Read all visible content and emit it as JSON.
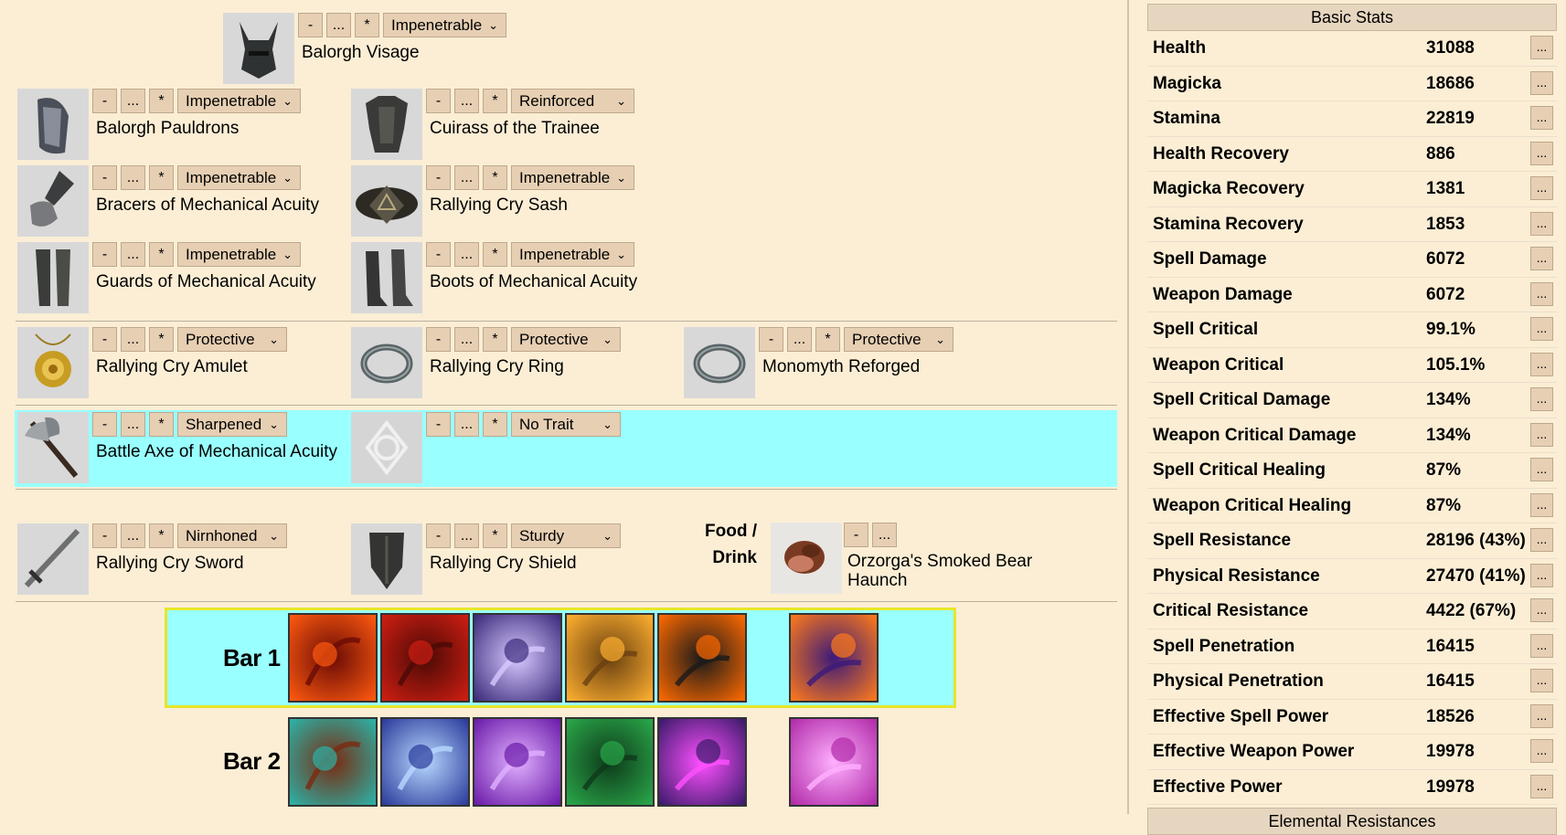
{
  "controls": {
    "minus": "-",
    "dots": "...",
    "star": "*"
  },
  "gear": {
    "head": {
      "name": "Balorgh Visage",
      "trait": "Impenetrable",
      "icon": "helmet-icon"
    },
    "shoulders": {
      "name": "Balorgh Pauldrons",
      "trait": "Impenetrable",
      "icon": "pauldron-icon"
    },
    "chest": {
      "name": "Cuirass of the Trainee",
      "trait": "Reinforced",
      "icon": "cuirass-icon"
    },
    "hands": {
      "name": "Bracers of Mechanical Acuity",
      "trait": "Impenetrable",
      "icon": "gauntlet-icon"
    },
    "waist": {
      "name": "Rallying Cry Sash",
      "trait": "Impenetrable",
      "icon": "belt-icon"
    },
    "legs": {
      "name": "Guards of Mechanical Acuity",
      "trait": "Impenetrable",
      "icon": "greaves-icon"
    },
    "feet": {
      "name": "Boots of Mechanical Acuity",
      "trait": "Impenetrable",
      "icon": "boots-icon"
    },
    "neck": {
      "name": "Rallying Cry Amulet",
      "trait": "Protective",
      "icon": "amulet-icon"
    },
    "ring1": {
      "name": "Rallying Cry Ring",
      "trait": "Protective",
      "icon": "ring-icon"
    },
    "ring2": {
      "name": "Monomyth Reforged",
      "trait": "Protective",
      "icon": "ring-icon"
    },
    "main1": {
      "name": "Battle Axe of Mechanical Acuity",
      "trait": "Sharpened",
      "icon": "battle-axe-icon"
    },
    "off1": {
      "name": "",
      "trait": "No Trait",
      "icon": "empty-slot-icon"
    },
    "main2": {
      "name": "Rallying Cry Sword",
      "trait": "Nirnhoned",
      "icon": "sword-icon"
    },
    "off2": {
      "name": "Rallying Cry Shield",
      "trait": "Sturdy",
      "icon": "shield-icon"
    }
  },
  "food": {
    "label_line1": "Food /",
    "label_line2": "Drink",
    "name_line1": "Orzorga's Smoked Bear",
    "name_line2": "Haunch",
    "icon": "meat-icon"
  },
  "bars": [
    {
      "label": "Bar 1",
      "skills": [
        "fire-fist-icon",
        "crossed-blades-icon",
        "dark-mage-icon",
        "winged-warrior-icon",
        "fire-ring-icon",
        "ultimate-leap-icon"
      ]
    },
    {
      "label": "Bar 2",
      "skills": [
        "spider-icon",
        "lightning-mage-icon",
        "purple-aura-icon",
        "green-spirit-icon",
        "magenta-slash-icon",
        "arcane-burst-icon"
      ]
    }
  ],
  "stats": {
    "header": "Basic Stats",
    "footer": "Elemental Resistances",
    "rows": [
      {
        "name": "Health",
        "value": "31088"
      },
      {
        "name": "Magicka",
        "value": "18686"
      },
      {
        "name": "Stamina",
        "value": "22819"
      },
      {
        "name": "Health Recovery",
        "value": "886"
      },
      {
        "name": "Magicka Recovery",
        "value": "1381"
      },
      {
        "name": "Stamina Recovery",
        "value": "1853"
      },
      {
        "name": "Spell Damage",
        "value": "6072"
      },
      {
        "name": "Weapon Damage",
        "value": "6072"
      },
      {
        "name": "Spell Critical",
        "value": "99.1%"
      },
      {
        "name": "Weapon Critical",
        "value": "105.1%"
      },
      {
        "name": "Spell Critical Damage",
        "value": "134%"
      },
      {
        "name": "Weapon Critical Damage",
        "value": "134%"
      },
      {
        "name": "Spell Critical Healing",
        "value": "87%"
      },
      {
        "name": "Weapon Critical Healing",
        "value": "87%"
      },
      {
        "name": "Spell Resistance",
        "value": "28196 (43%)"
      },
      {
        "name": "Physical Resistance",
        "value": "27470 (41%)"
      },
      {
        "name": "Critical Resistance",
        "value": "4422 (67%)"
      },
      {
        "name": "Spell Penetration",
        "value": "16415"
      },
      {
        "name": "Physical Penetration",
        "value": "16415"
      },
      {
        "name": "Effective Spell Power",
        "value": "18526"
      },
      {
        "name": "Effective Weapon Power",
        "value": "19978"
      },
      {
        "name": "Effective Power",
        "value": "19978"
      }
    ],
    "row_button": "..."
  }
}
